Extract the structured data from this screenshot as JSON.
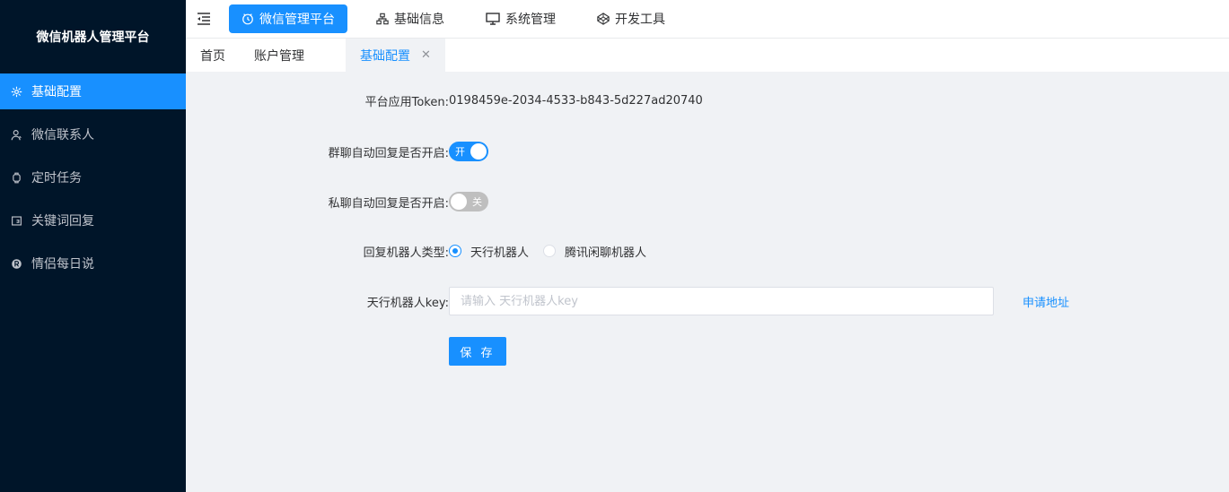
{
  "app": {
    "title": "微信机器人管理平台"
  },
  "sidebar": {
    "items": [
      {
        "label": "基础配置",
        "icon": "gear-icon",
        "active": true
      },
      {
        "label": "微信联系人",
        "icon": "user-icon",
        "active": false
      },
      {
        "label": "定时任务",
        "icon": "watch-icon",
        "active": false
      },
      {
        "label": "关键词回复",
        "icon": "reply-icon",
        "active": false
      },
      {
        "label": "情侣每日说",
        "icon": "registered-icon",
        "active": false
      }
    ]
  },
  "topnav": {
    "items": [
      {
        "label": "微信管理平台",
        "icon": "timer-icon",
        "active": true
      },
      {
        "label": "基础信息",
        "icon": "sitemap-icon",
        "active": false
      },
      {
        "label": "系统管理",
        "icon": "monitor-icon",
        "active": false
      },
      {
        "label": "开发工具",
        "icon": "codepen-icon",
        "active": false
      }
    ]
  },
  "tabs": {
    "items": [
      {
        "label": "首页",
        "active": false
      },
      {
        "label": "账户管理",
        "active": false
      },
      {
        "label": "基础配置",
        "active": true,
        "closable": true
      }
    ]
  },
  "form": {
    "token": {
      "label": "平台应用Token:",
      "value": "0198459e-2034-4533-b843-5d227ad20740"
    },
    "group_reply": {
      "label": "群聊自动回复是否开启:",
      "on": true,
      "on_text": "开"
    },
    "private_reply": {
      "label": "私聊自动回复是否开启:",
      "on": false,
      "off_text": "关"
    },
    "robot_type": {
      "label": "回复机器人类型:",
      "options": [
        {
          "label": "天行机器人",
          "checked": true
        },
        {
          "label": "腾讯闲聊机器人",
          "checked": false
        }
      ]
    },
    "robot_key": {
      "label": "天行机器人key:",
      "placeholder": "请输入 天行机器人key",
      "value": "",
      "link": "申请地址"
    },
    "save": "保 存"
  },
  "colors": {
    "primary": "#1890ff",
    "sidebar_bg": "#001529",
    "content_bg": "#f0f2f5"
  }
}
